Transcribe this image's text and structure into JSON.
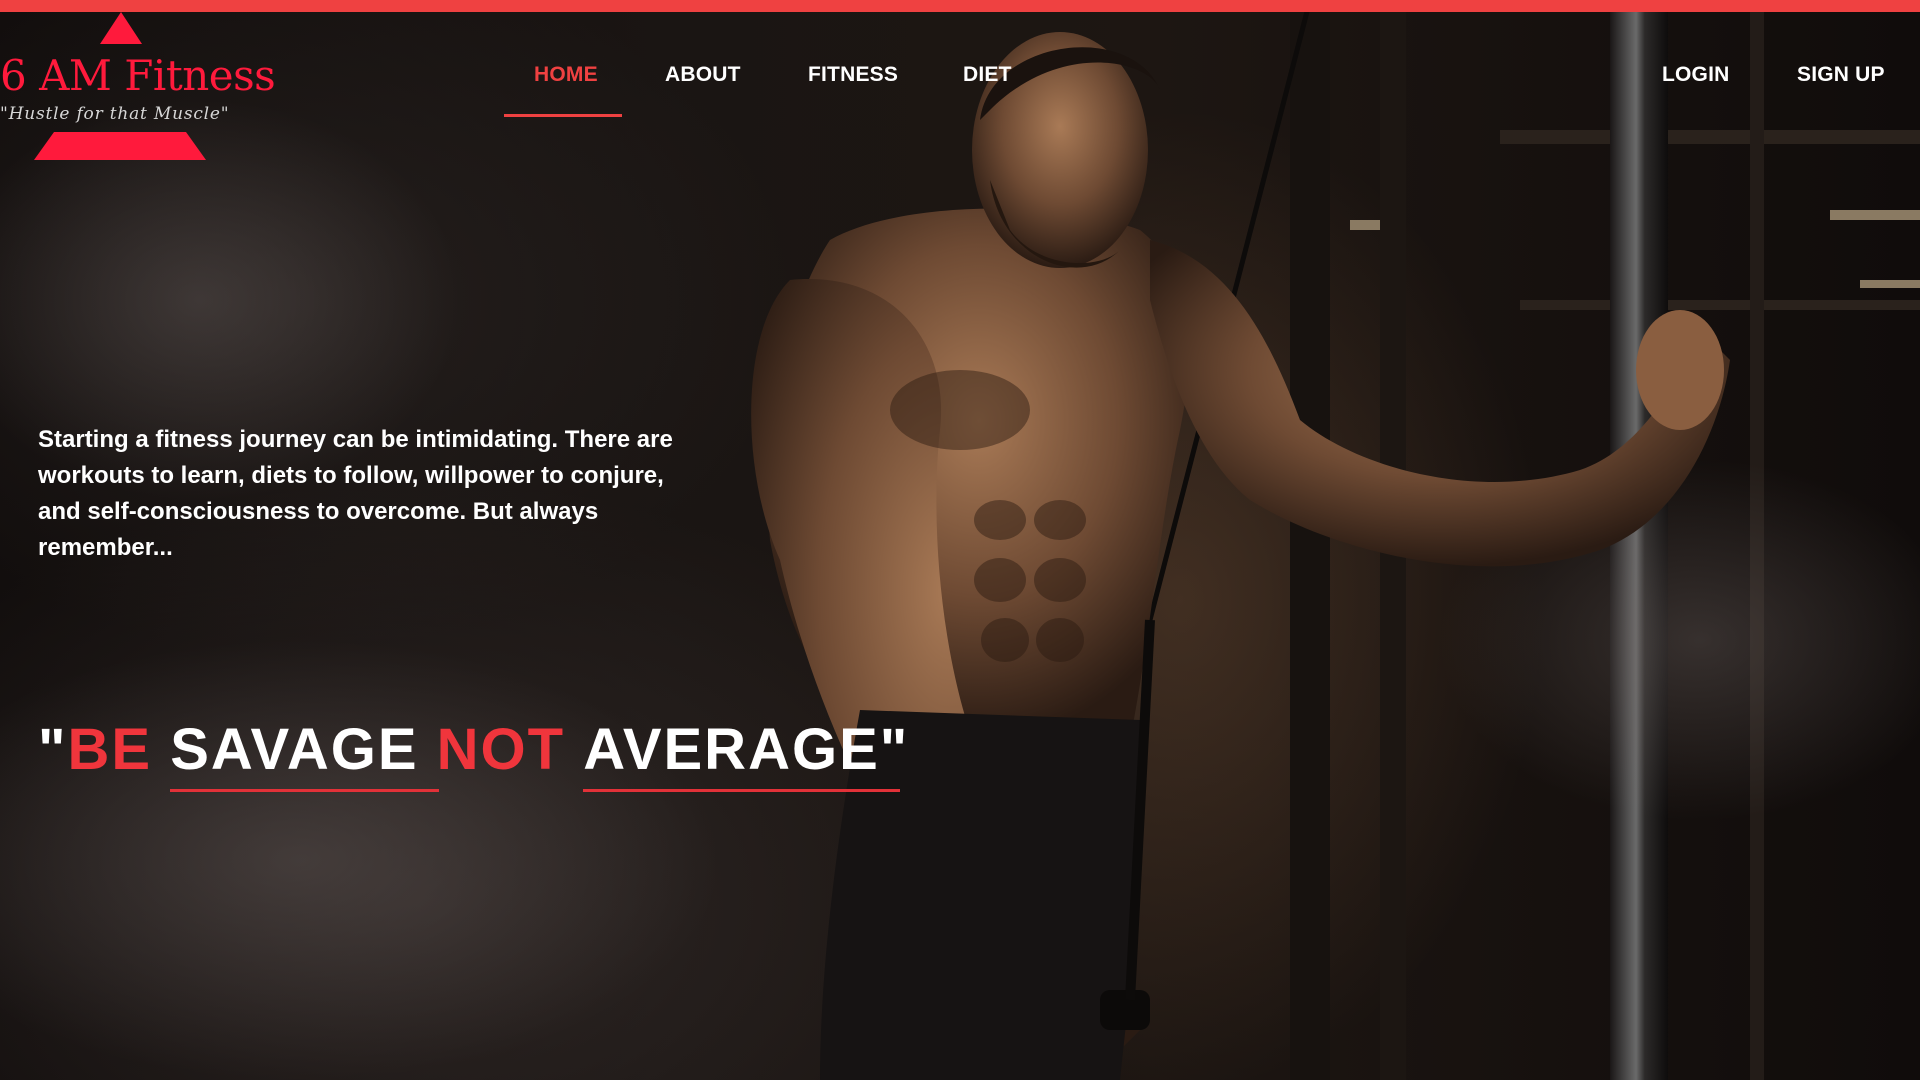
{
  "colors": {
    "accent": "#ef4141",
    "brand_red": "#ff1a3c",
    "quote_red": "#f0353c",
    "text": "#ffffff"
  },
  "logo": {
    "title": "6 AM Fitness",
    "tagline": "\"Hustle for that Muscle\"",
    "icon": "red-triangle-logo-icon"
  },
  "nav": {
    "items": [
      {
        "label": "HOME",
        "active": true
      },
      {
        "label": "ABOUT",
        "active": false
      },
      {
        "label": "FITNESS",
        "active": false
      },
      {
        "label": "DIET",
        "active": false
      }
    ],
    "auth": {
      "login": "LOGIN",
      "signup": "SIGN UP"
    }
  },
  "hero": {
    "intro": "Starting a fitness journey can be intimidating. There are workouts to learn, diets to follow, willpower to conjure, and self-consciousness to overcome. But always remember...",
    "quote": {
      "open": "\"",
      "w1": "BE",
      "w2": "SAVAGE",
      "w3": "NOT",
      "w4": "AVERAGE",
      "close": "\""
    }
  }
}
